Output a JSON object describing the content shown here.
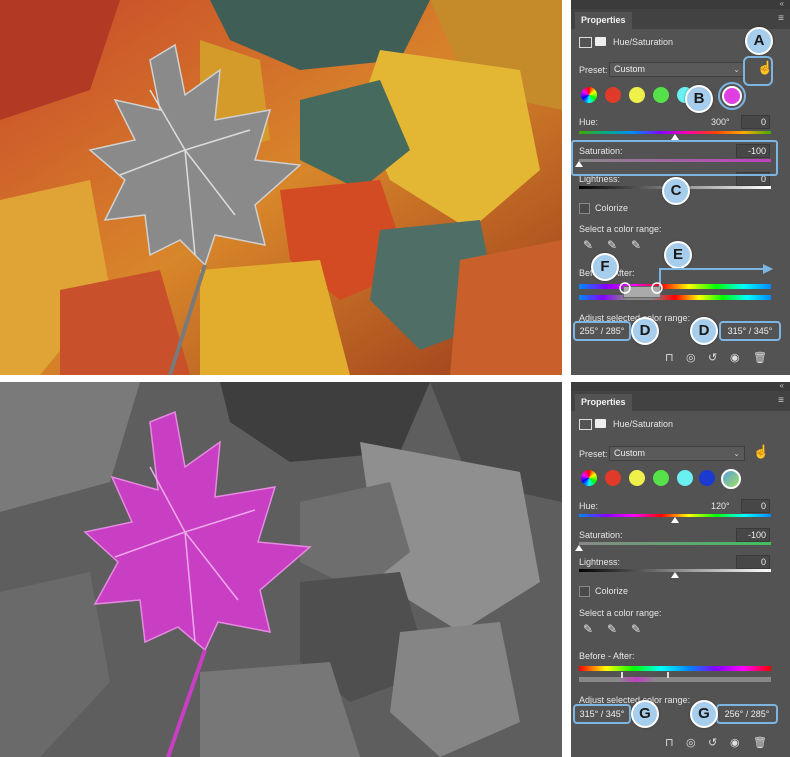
{
  "colors": {
    "panel_bg": "#535353",
    "callout_fill": "#a7cdec",
    "callout_border": "#7eb4e0",
    "magenta": "#c83fc4"
  },
  "top_panel": {
    "tab_title": "Properties",
    "adjustment_name": "Hue/Saturation",
    "preset_label": "Preset:",
    "preset_value": "Custom",
    "hue_label": "Hue:",
    "hue_value": "300°",
    "hue_field": "0",
    "saturation_label": "Saturation:",
    "saturation_value": "-100",
    "lightness_label": "Lightness:",
    "lightness_value": "0",
    "colorize_label": "Colorize",
    "select_range_label": "Select a color range:",
    "before_after_label": "Before - After:",
    "adjust_range_label": "Adjust selected color range:",
    "range_left": "255° / 285°",
    "range_right": "315° / 345°",
    "callouts": {
      "a": "A",
      "b": "B",
      "c": "C",
      "d1": "D",
      "d2": "D",
      "e": "E",
      "f": "F"
    }
  },
  "bottom_panel": {
    "tab_title": "Properties",
    "adjustment_name": "Hue/Saturation",
    "preset_label": "Preset:",
    "preset_value": "Custom",
    "hue_label": "Hue:",
    "hue_value": "120°",
    "hue_field": "0",
    "saturation_label": "Saturation:",
    "saturation_value": "-100",
    "lightness_label": "Lightness:",
    "lightness_value": "0",
    "colorize_label": "Colorize",
    "select_range_label": "Select a color range:",
    "before_after_label": "Before - After:",
    "adjust_range_label": "Adjust selected color range:",
    "range_left": "315° / 345°",
    "range_right": "256° / 285°",
    "callouts": {
      "g1": "G",
      "g2": "G"
    }
  },
  "icons": [
    "adjustment-layer-icon",
    "mask-icon",
    "targeted-adjustment-hand-icon",
    "eyedropper-icon",
    "eyedropper-plus-icon",
    "eyedropper-minus-icon",
    "clip-to-layer-icon",
    "view-previous-icon",
    "reset-icon",
    "visibility-eye-icon",
    "trash-icon",
    "panel-menu-icon"
  ]
}
